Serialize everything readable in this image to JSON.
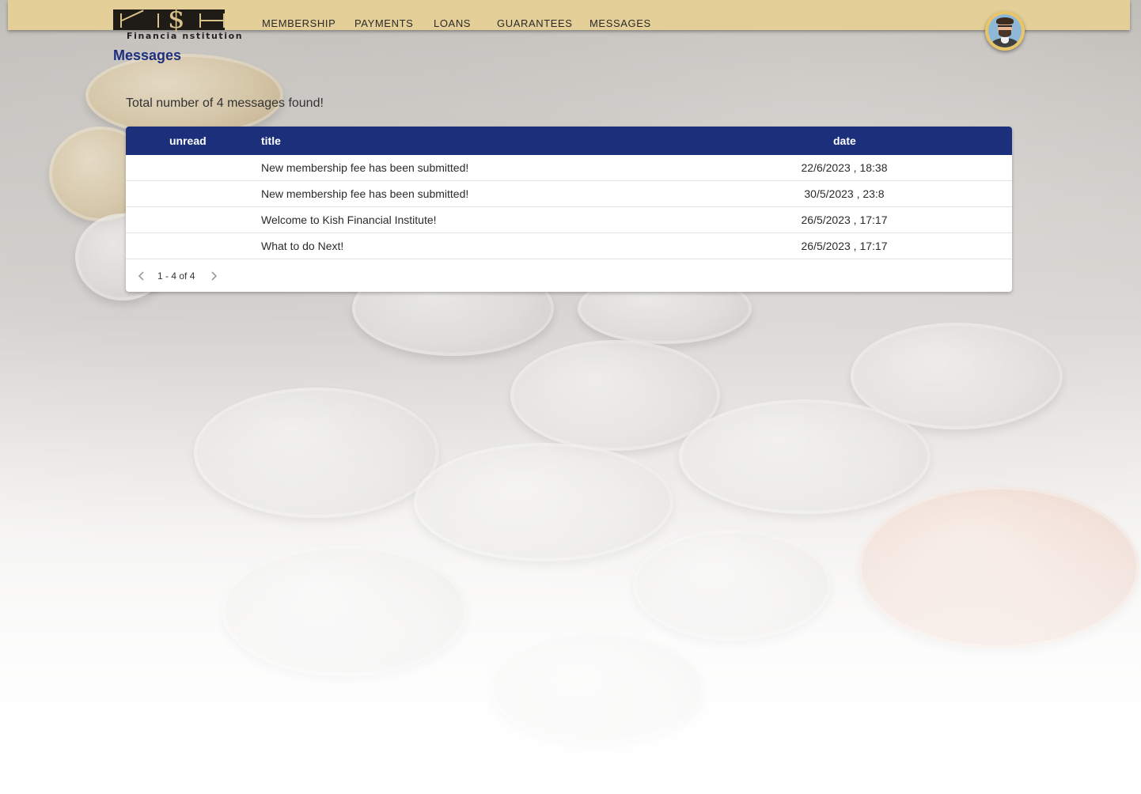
{
  "brand": {
    "logo_text": "Financia  nstitution",
    "logo_letters": "K S H"
  },
  "nav": {
    "items": [
      {
        "label": "MEMBERSHIP"
      },
      {
        "label": "PAYMENTS"
      },
      {
        "label": "LOANS"
      },
      {
        "label": "GUARANTEES"
      },
      {
        "label": "MESSAGES"
      }
    ]
  },
  "page": {
    "title": "Messages",
    "summary": "Total number of 4 messages found!"
  },
  "table": {
    "columns": {
      "unread": "unread",
      "title": "title",
      "date": "date"
    },
    "rows": [
      {
        "unread": "",
        "title": "New membership fee has been submitted!",
        "date": "22/6/2023 , 18:38"
      },
      {
        "unread": "",
        "title": "New membership fee has been submitted!",
        "date": "30/5/2023 , 23:8"
      },
      {
        "unread": "",
        "title": "Welcome to Kish Financial Institute!",
        "date": "26/5/2023 , 17:17"
      },
      {
        "unread": "",
        "title": "What to do Next!",
        "date": "26/5/2023 , 17:17"
      }
    ],
    "pagination": {
      "range": "1 - 4 of 4",
      "prev_icon": "chevron-left-icon",
      "next_icon": "chevron-right-icon"
    }
  },
  "colors": {
    "header_bg": "#e4cf98",
    "table_header_bg": "#1b2f7b",
    "title_color": "#1d2f7e",
    "avatar_ring": "#e9c56a"
  }
}
